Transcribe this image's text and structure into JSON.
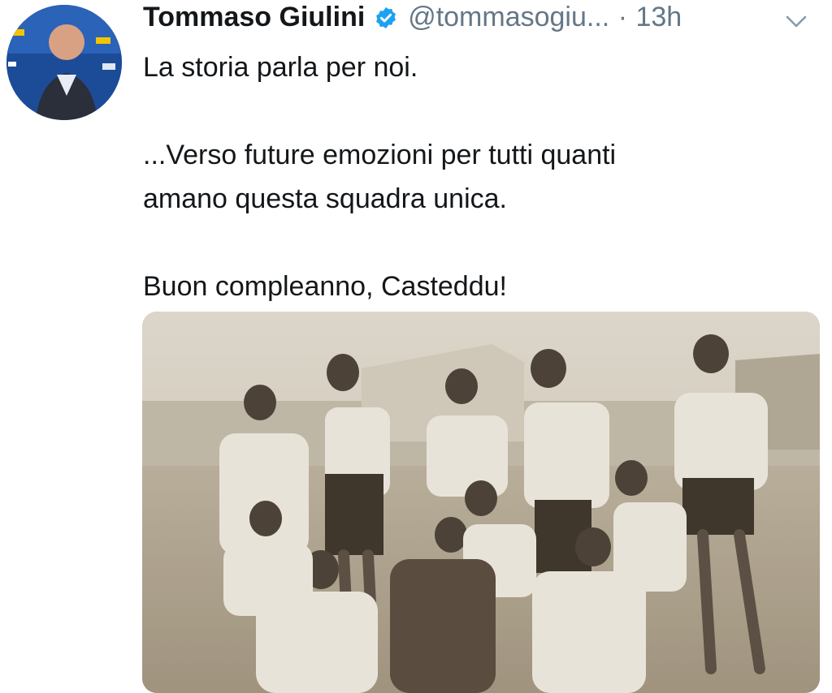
{
  "tweet": {
    "author_name": "Tommaso Giulini",
    "handle": "@tommasogiu...",
    "separator": "·",
    "time": "13h",
    "lines": [
      "La storia parla per noi.",
      "...Verso future emozioni per tutti quanti",
      "amano questa squadra unica.",
      "Buon compleanno, Casteddu!"
    ]
  },
  "icons": {
    "verified": "verified-badge-icon",
    "menu": "chevron-down-icon"
  },
  "colors": {
    "text": "#14171a",
    "muted": "#657786",
    "verified": "#1da1f2"
  }
}
